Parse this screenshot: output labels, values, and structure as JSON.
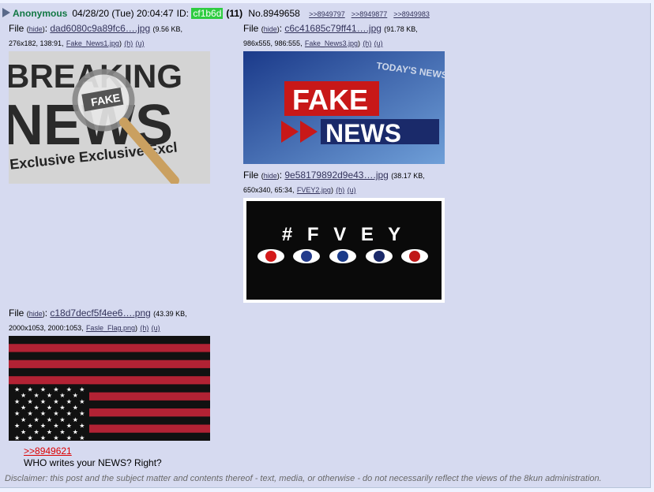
{
  "post": {
    "name": "Anonymous",
    "date": "04/28/20 (Tue) 20:04:47",
    "id_label": "ID:",
    "id_value": "cf1b6d",
    "count": "(11)",
    "number": "No.8949658",
    "backlinks": [
      ">>8949797",
      ">>8949877",
      ">>8949983"
    ],
    "colors": {
      "name": "#117743",
      "id_bg": "#2ecc40",
      "link": "#34345c",
      "quote": "#dd0000",
      "bg": "#d6daf0"
    }
  },
  "files": [
    {
      "label": "File",
      "hide": "hide",
      "name": "dad6080c9a89fc6….jpg",
      "meta1": "(9.56 KB,",
      "meta2": "276x182, 138:91,",
      "orig": "Fake_News1.jpg",
      "h": "(h)",
      "u": "(u)",
      "thumb_text_top": "BREAKING",
      "thumb_text_mid": "NEWS",
      "thumb_text_bottom": "Exclusive Exclusive Excl",
      "thumb_badge": "FAKE"
    },
    {
      "label": "File",
      "hide": "hide",
      "name": "c6c41685c79ff41….jpg",
      "meta1": "(91.78 KB,",
      "meta2": "986x555, 986:555,",
      "orig": "Fake_News3.jpg",
      "h": "(h)",
      "u": "(u)",
      "thumb_text_top": "FAKE",
      "thumb_text_bottom": "NEWS",
      "thumb_corner": "TODAY'S NEWS"
    },
    {
      "label": "File",
      "hide": "hide",
      "name": "9e58179892d9e43….jpg",
      "meta1": "(38.17 KB,",
      "meta2": "650x340, 65:34,",
      "orig": "FVEY2.jpg",
      "h": "(h)",
      "u": "(u)",
      "thumb_text": "# F V E Y"
    },
    {
      "label": "File",
      "hide": "hide",
      "name": "c18d7decf5f4ee6….png",
      "meta1": "(43.39 KB,",
      "meta2": "2000x1053, 2000:1053,",
      "orig": "Fasle_Flag.png",
      "h": "(h)",
      "u": "(u)"
    }
  ],
  "message": {
    "quote": ">>8949621",
    "text": "WHO writes your NEWS? Right?"
  },
  "disclaimer": "Disclaimer: this post and the subject matter and contents thereof - text, media, or otherwise - do not necessarily reflect the views of the 8kun administration."
}
